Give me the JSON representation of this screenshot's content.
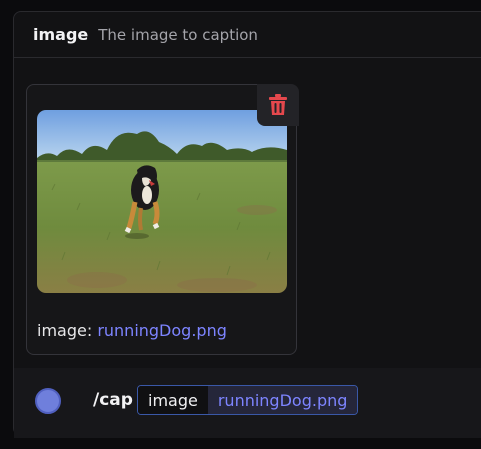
{
  "option": {
    "name": "image",
    "description": "The image to caption"
  },
  "attachment": {
    "label_prefix": "image: ",
    "filename": "runningDog.png",
    "delete_icon": "trash-icon",
    "image_subject": "dog running across a grassy field"
  },
  "command": {
    "name": "/cap",
    "option_name": "image",
    "option_value": "runningDog.png"
  },
  "colors": {
    "accent_link": "#7d84ff",
    "delete_red": "#e5484d",
    "avatar": "#6f7fdc"
  }
}
